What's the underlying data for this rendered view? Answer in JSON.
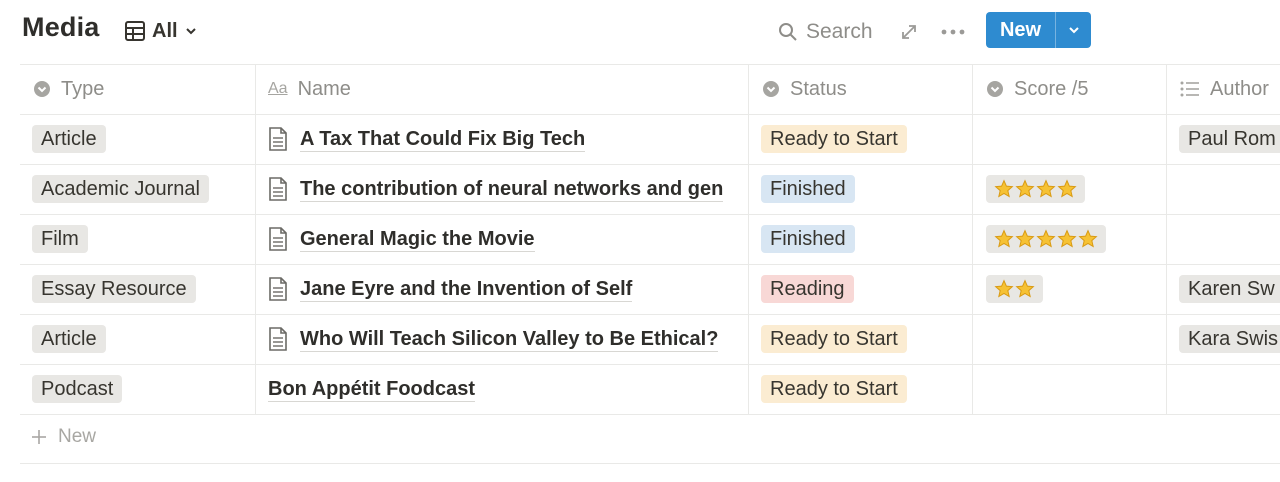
{
  "header": {
    "title": "Media",
    "view_label": "All",
    "search_label": "Search",
    "new_label": "New"
  },
  "columns": [
    "Type",
    "Name",
    "Status",
    "Score /5",
    "Author"
  ],
  "rows": [
    {
      "type": "Article",
      "name": "A Tax That Could Fix Big Tech",
      "status": "Ready to Start",
      "score": 0,
      "author": "Paul Rom"
    },
    {
      "type": "Academic Journal",
      "name": "The contribution of neural networks and gen",
      "status": "Finished",
      "score": 4,
      "author": ""
    },
    {
      "type": "Film",
      "name": "General Magic the Movie",
      "status": "Finished",
      "score": 5,
      "author": ""
    },
    {
      "type": "Essay Resource",
      "name": "Jane Eyre and the Invention of Self",
      "status": "Reading",
      "score": 2,
      "author": "Karen Sw"
    },
    {
      "type": "Article",
      "name": "Who Will Teach Silicon Valley to Be Ethical?",
      "status": "Ready to Start",
      "score": 0,
      "author": "Kara Swis"
    },
    {
      "type": "Podcast",
      "name": "Bon Appétit Foodcast",
      "status": "Ready to Start",
      "score": 0,
      "author": ""
    }
  ],
  "add_row_label": "New",
  "colors": {
    "accent": "#2e8bd0",
    "ready_to_start": "#fbecd2",
    "finished": "#d8e6f3",
    "reading": "#f8d8d6",
    "gray_tag": "#e8e7e4"
  }
}
